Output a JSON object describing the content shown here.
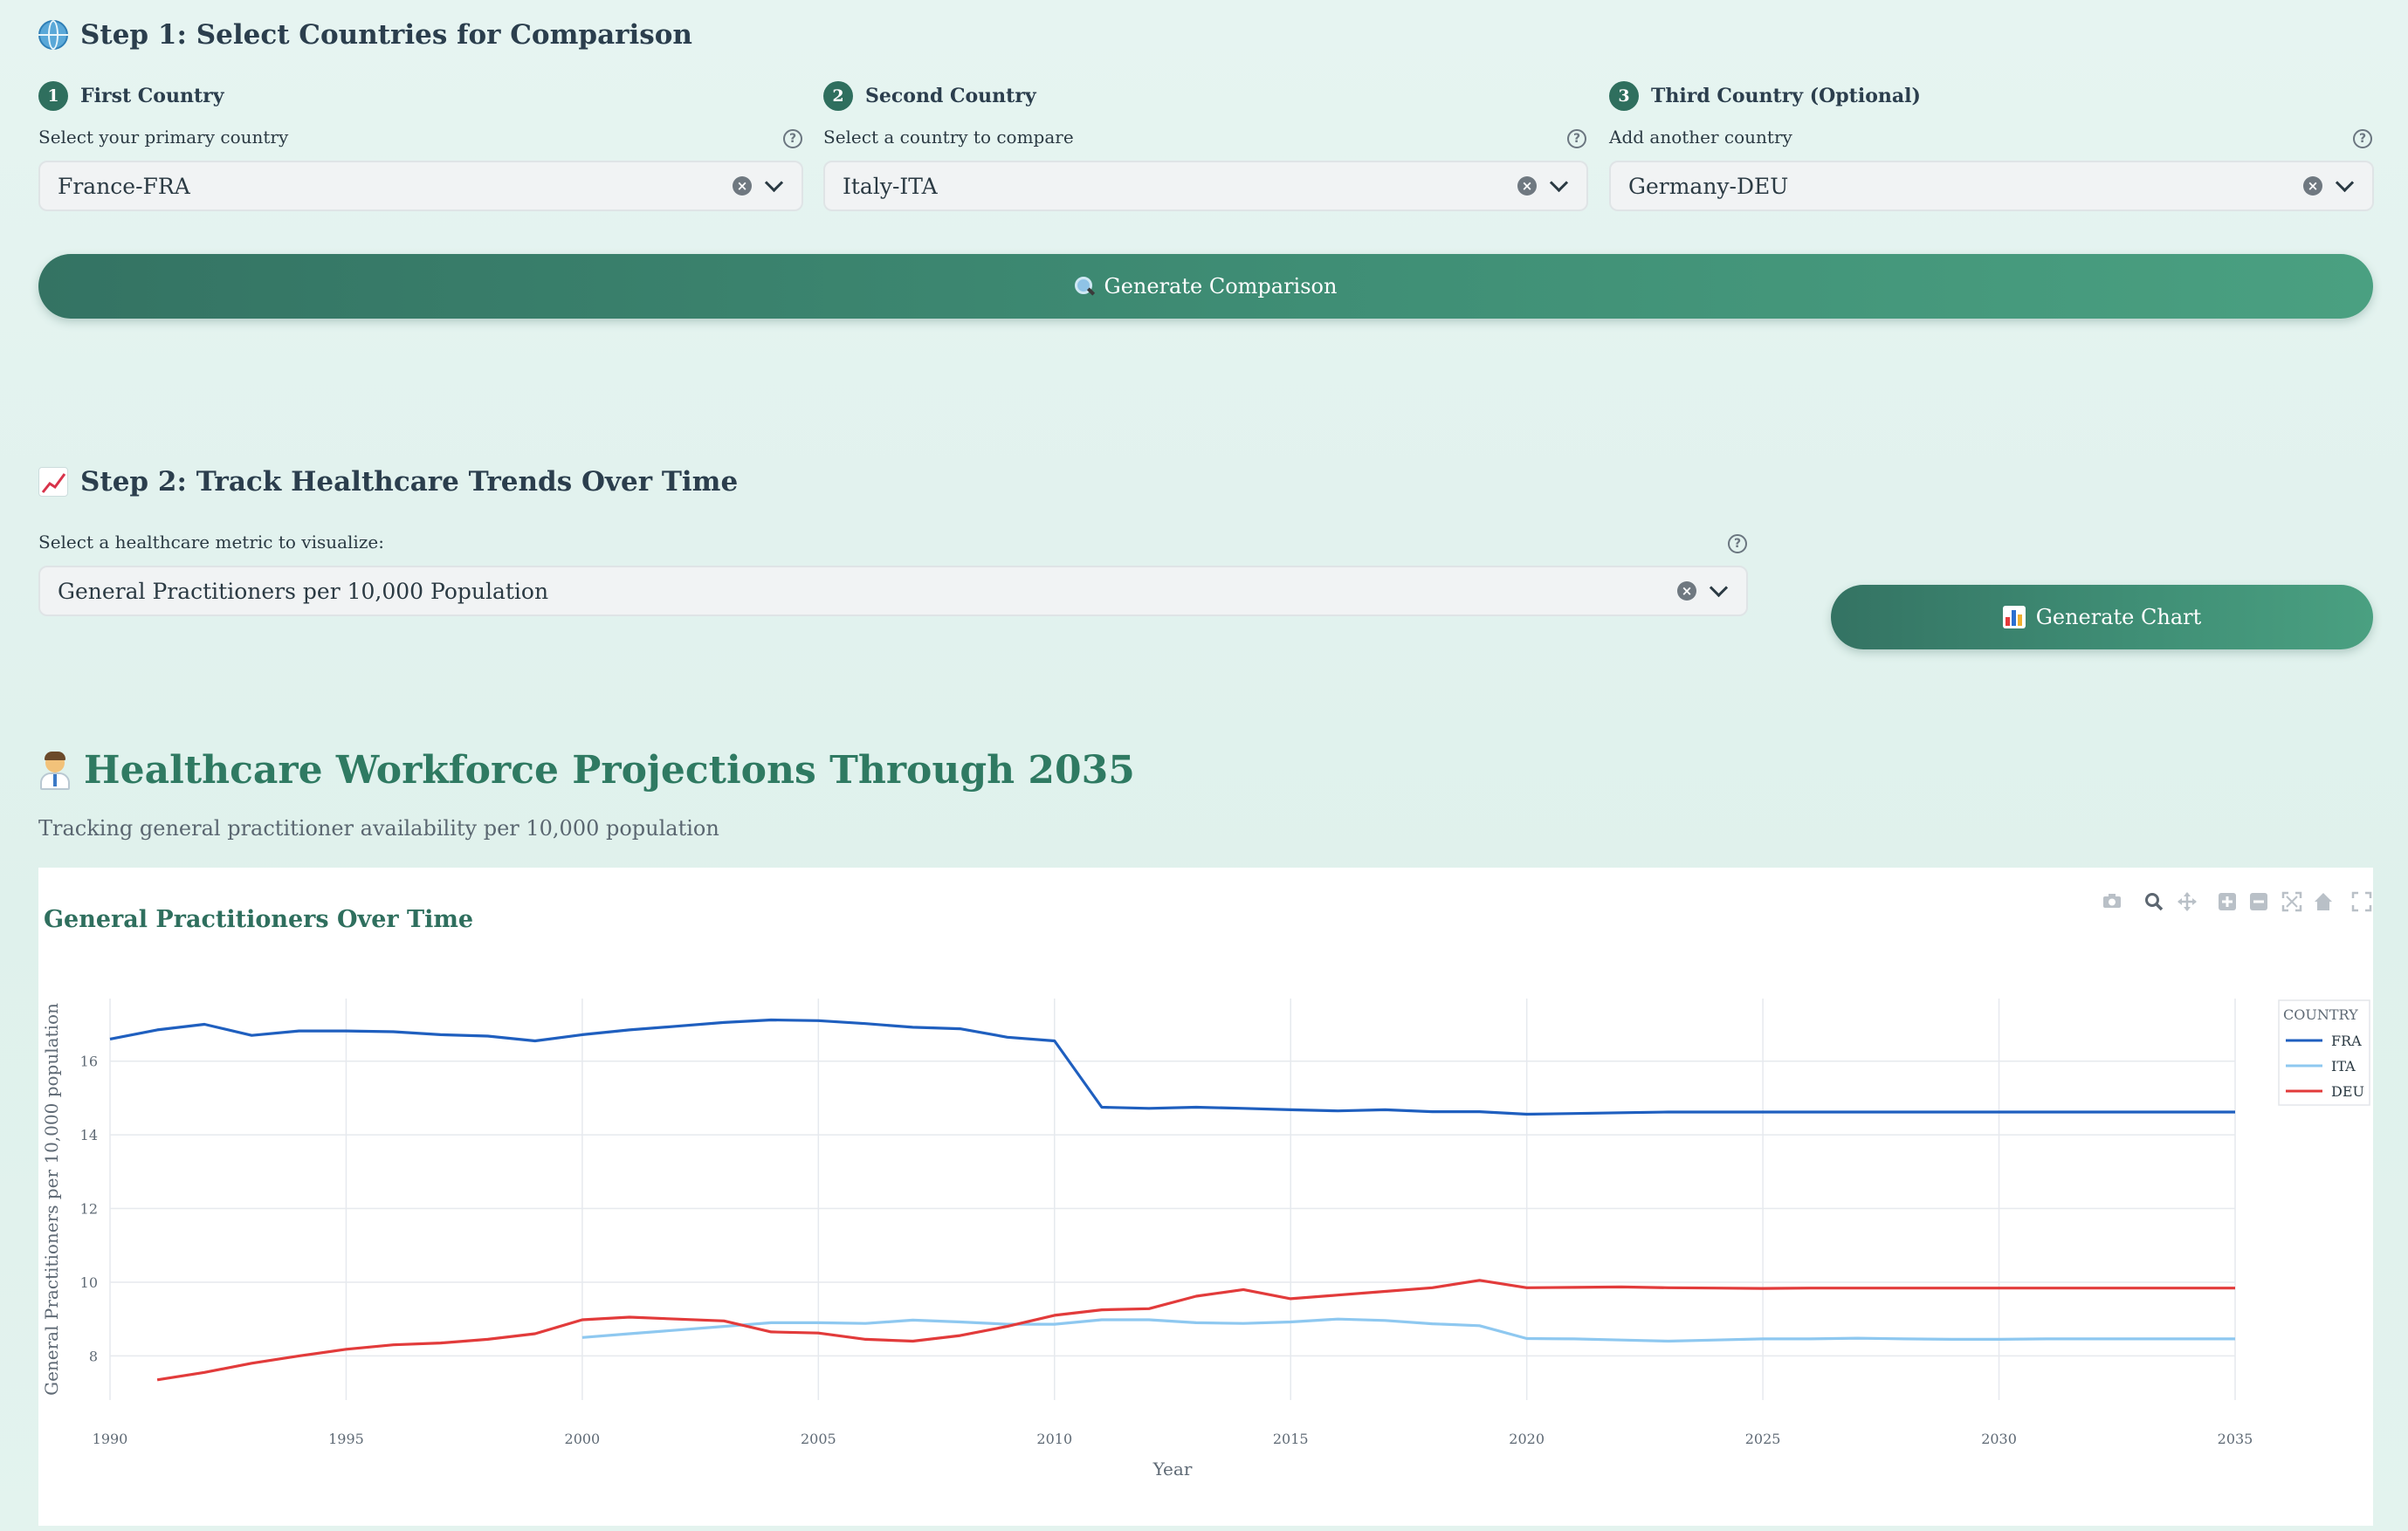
{
  "step1": {
    "title": "Step 1: Select Countries for Comparison",
    "columns": [
      {
        "num": "1",
        "heading": "First Country",
        "label": "Select your primary country",
        "value": "France-FRA"
      },
      {
        "num": "2",
        "heading": "Second Country",
        "label": "Select a country to compare",
        "value": "Italy-ITA"
      },
      {
        "num": "3",
        "heading": "Third Country (Optional)",
        "label": "Add another country",
        "value": "Germany-DEU"
      }
    ],
    "button_label": "Generate Comparison"
  },
  "step2": {
    "title": "Step 2: Track Healthcare Trends Over Time",
    "metric_label": "Select a healthcare metric to visualize:",
    "metric_value": "General Practitioners per 10,000 Population",
    "button_label": "Generate Chart"
  },
  "section": {
    "title": "Healthcare Workforce Projections Through 2035",
    "description": "Tracking general practitioner availability per 10,000 population"
  },
  "toolbar": [
    "camera-icon",
    "zoom-icon",
    "pan-icon",
    "zoom-in-icon",
    "zoom-out-icon",
    "autoscale-icon",
    "home-icon",
    "fullscreen-icon"
  ],
  "chart_data": {
    "type": "line",
    "title": "General Practitioners Over Time",
    "xlabel": "Year",
    "ylabel": "General Practitioners per 10,000 population",
    "xlim": [
      1990,
      2035
    ],
    "ylim": [
      6.8,
      17.7
    ],
    "xticks": [
      1990,
      1995,
      2000,
      2005,
      2010,
      2015,
      2020,
      2025,
      2030,
      2035
    ],
    "yticks": [
      8,
      10,
      12,
      14,
      16
    ],
    "grid": true,
    "legend": {
      "title": "COUNTRY",
      "position": "top-right"
    },
    "series": [
      {
        "name": "FRA",
        "color": "#1f5fbf",
        "x": [
          1990,
          1991,
          1992,
          1993,
          1994,
          1995,
          1996,
          1997,
          1998,
          1999,
          2000,
          2001,
          2002,
          2003,
          2004,
          2005,
          2006,
          2007,
          2008,
          2009,
          2010,
          2011,
          2012,
          2013,
          2014,
          2015,
          2016,
          2017,
          2018,
          2019,
          2020,
          2021,
          2022,
          2023,
          2024,
          2025,
          2026,
          2027,
          2028,
          2029,
          2030,
          2031,
          2032,
          2033,
          2034,
          2035
        ],
        "y": [
          16.6,
          16.85,
          17.0,
          16.7,
          16.82,
          16.82,
          16.8,
          16.72,
          16.68,
          16.55,
          16.72,
          16.85,
          16.95,
          17.05,
          17.12,
          17.1,
          17.02,
          16.92,
          16.88,
          16.65,
          16.55,
          14.75,
          14.72,
          14.75,
          14.72,
          14.68,
          14.65,
          14.68,
          14.63,
          14.63,
          14.56,
          14.58,
          14.6,
          14.62,
          14.62,
          14.62,
          14.62,
          14.62,
          14.62,
          14.62,
          14.62,
          14.62,
          14.62,
          14.62,
          14.62,
          14.62
        ]
      },
      {
        "name": "ITA",
        "color": "#8ec8f0",
        "x": [
          2000,
          2001,
          2002,
          2003,
          2004,
          2005,
          2006,
          2007,
          2008,
          2009,
          2010,
          2011,
          2012,
          2013,
          2014,
          2015,
          2016,
          2017,
          2018,
          2019,
          2020,
          2021,
          2022,
          2023,
          2024,
          2025,
          2026,
          2027,
          2028,
          2029,
          2030,
          2031,
          2032,
          2033,
          2034,
          2035
        ],
        "y": [
          8.5,
          8.6,
          8.7,
          8.8,
          8.9,
          8.9,
          8.88,
          8.97,
          8.92,
          8.86,
          8.86,
          8.98,
          8.98,
          8.9,
          8.88,
          8.92,
          9.0,
          8.96,
          8.87,
          8.82,
          8.47,
          8.46,
          8.43,
          8.4,
          8.43,
          8.46,
          8.46,
          8.48,
          8.46,
          8.45,
          8.45,
          8.46,
          8.46,
          8.46,
          8.46,
          8.46
        ]
      },
      {
        "name": "DEU",
        "color": "#e23b3b",
        "x": [
          1991,
          1992,
          1993,
          1994,
          1995,
          1996,
          1997,
          1998,
          1999,
          2000,
          2001,
          2002,
          2003,
          2004,
          2005,
          2006,
          2007,
          2008,
          2009,
          2010,
          2011,
          2012,
          2013,
          2014,
          2015,
          2016,
          2017,
          2018,
          2019,
          2020,
          2021,
          2022,
          2023,
          2024,
          2025,
          2026,
          2027,
          2028,
          2029,
          2030,
          2031,
          2032,
          2033,
          2034,
          2035
        ],
        "y": [
          7.35,
          7.55,
          7.8,
          8.0,
          8.18,
          8.3,
          8.35,
          8.45,
          8.6,
          8.98,
          9.05,
          9.0,
          8.95,
          8.65,
          8.62,
          8.45,
          8.4,
          8.55,
          8.8,
          9.1,
          9.25,
          9.28,
          9.62,
          9.8,
          9.55,
          9.65,
          9.75,
          9.85,
          10.05,
          9.85,
          9.86,
          9.87,
          9.85,
          9.84,
          9.83,
          9.84,
          9.84,
          9.84,
          9.84,
          9.84,
          9.84,
          9.84,
          9.84,
          9.84,
          9.84
        ]
      }
    ]
  }
}
